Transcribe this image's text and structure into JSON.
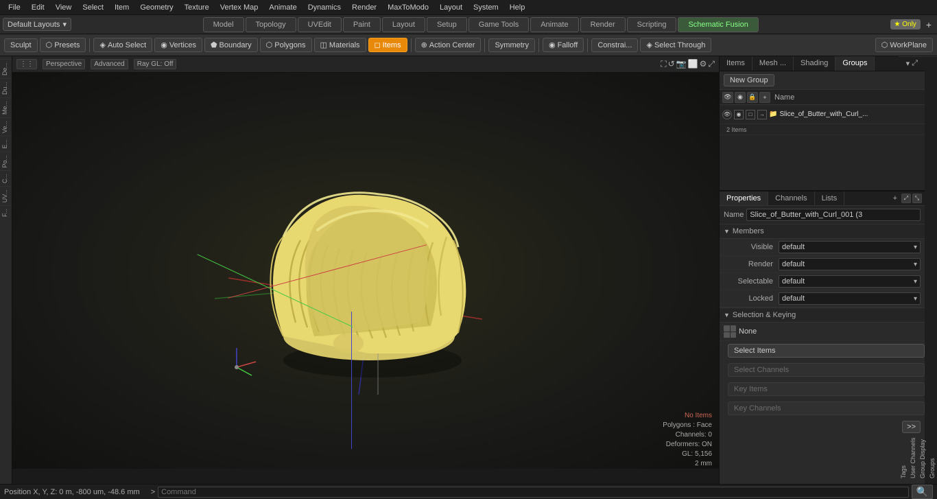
{
  "menu": {
    "items": [
      "File",
      "Edit",
      "View",
      "Select",
      "Item",
      "Geometry",
      "Texture",
      "Vertex Map",
      "Animate",
      "Dynamics",
      "Render",
      "MaxToModo",
      "Layout",
      "System",
      "Help"
    ]
  },
  "layout_bar": {
    "dropdown_label": "Default Layouts",
    "tabs": [
      "Model",
      "Topology",
      "UVEdit",
      "Paint",
      "Layout",
      "Setup",
      "Game Tools",
      "Animate",
      "Render",
      "Scripting",
      "Schematic Fusion"
    ],
    "star_label": "★ Only",
    "plus": "+"
  },
  "toolbar": {
    "sculpt": "Sculpt",
    "presets": "Presets",
    "auto_select": "Auto Select",
    "vertices": "Vertices",
    "boundary": "Boundary",
    "polygons": "Polygons",
    "materials": "Materials",
    "items": "Items",
    "action_center": "Action Center",
    "symmetry": "Symmetry",
    "falloff": "Falloff",
    "constraints": "Constrai...",
    "select_through": "Select Through",
    "workplane": "WorkPlane"
  },
  "viewport": {
    "mode": "Perspective",
    "shade": "Advanced",
    "raygl": "Ray GL: Off",
    "status": {
      "no_items": "No Items",
      "polygons": "Polygons : Face",
      "channels": "Channels: 0",
      "deformers": "Deformers: ON",
      "gl": "GL: 5,156",
      "size": "2 mm"
    },
    "position": "Position X, Y, Z:  0 m, -800 um, -48.6 mm"
  },
  "side_tabs": {
    "left": [
      "De...",
      "Du...",
      "Me...",
      "Ve...",
      "E...",
      "Po...",
      "C...",
      "UV...",
      "F..."
    ]
  },
  "right_panel": {
    "tabs": {
      "items": "Items",
      "mesh": "Mesh ...",
      "shading": "Shading",
      "groups": "Groups"
    },
    "new_group_label": "New Group",
    "list_header": "Name",
    "group_name": "Slice_of_Butter_with_Curl_...",
    "group_count": "2 Items"
  },
  "properties": {
    "tabs": {
      "properties": "Properties",
      "channels": "Channels",
      "lists": "Lists"
    },
    "plus": "+",
    "name_label": "Name",
    "name_value": "Slice_of_Butter_with_Curl_001 (3",
    "members_label": "Members",
    "rows": [
      {
        "label": "Visible",
        "value": "default"
      },
      {
        "label": "Render",
        "value": "default"
      },
      {
        "label": "Selectable",
        "value": "default"
      },
      {
        "label": "Locked",
        "value": "default"
      }
    ],
    "sel_keying_label": "Selection & Keying",
    "none_label": "None",
    "btns": [
      "Select Items",
      "Select Channels",
      "Key Items",
      "Key Channels"
    ],
    "expand": ">>"
  },
  "right_side_tabs": [
    "Groups",
    "Group Display",
    "User Channels",
    "Tags"
  ],
  "status_bar": {
    "position": "Position X, Y, Z:  0 m, -800 um, -48.6 mm",
    "arrow": ">",
    "command_placeholder": "Command"
  }
}
